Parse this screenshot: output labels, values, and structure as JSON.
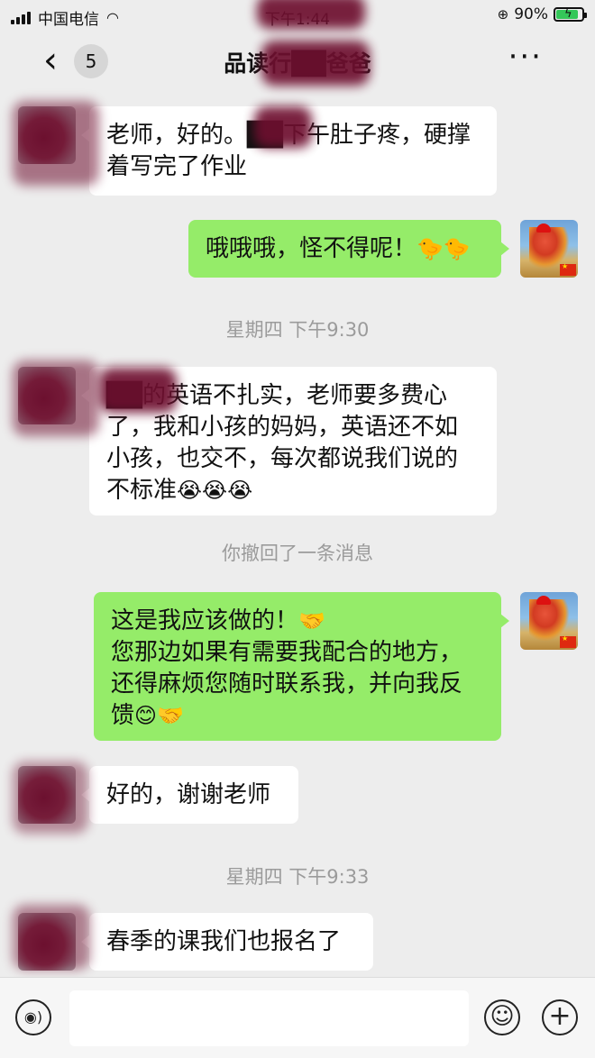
{
  "status_bar": {
    "carrier": "中国电信",
    "time": "下午1:44",
    "battery": "90%",
    "battery_level": 0.9
  },
  "nav": {
    "unread_count": "5",
    "title": "品读行██爸爸"
  },
  "messages": [
    {
      "side": "in",
      "text": "老师，好的。██下午肚子疼，硬撑着写完了作业"
    },
    {
      "side": "out",
      "text": "哦哦哦，怪不得呢！",
      "emojis": "🐤🐤"
    },
    {
      "type": "time",
      "text": "星期四 下午9:30"
    },
    {
      "side": "in",
      "text": "██的英语不扎实，老师要多费心了，我和小孩的妈妈，英语还不如小孩，也交不，每次都说我们说的不标准",
      "emojis": "😭😭😭"
    },
    {
      "type": "system",
      "text": "你撤回了一条消息"
    },
    {
      "side": "out",
      "text": "这是我应该做的！",
      "emoji1": "🤝",
      "text2": "您那边如果有需要我配合的地方，还得麻烦您随时联系我，并向我反馈",
      "emojis": "😊🤝"
    },
    {
      "side": "in",
      "text": "好的，谢谢老师"
    },
    {
      "type": "time",
      "text": "星期四 下午9:33"
    },
    {
      "side": "in",
      "text": "春季的课我们也报名了"
    }
  ],
  "input": {
    "placeholder": "",
    "value": ""
  },
  "icons": {
    "back": "chevron-left-icon",
    "more": "more-dots-icon",
    "voice": "voice-icon",
    "emoji": "emoji-icon",
    "plus": "plus-icon"
  },
  "colors": {
    "background": "#ededed",
    "bubble_in": "#ffffff",
    "bubble_out": "#95ec69",
    "system_text": "#9b9b9b"
  }
}
